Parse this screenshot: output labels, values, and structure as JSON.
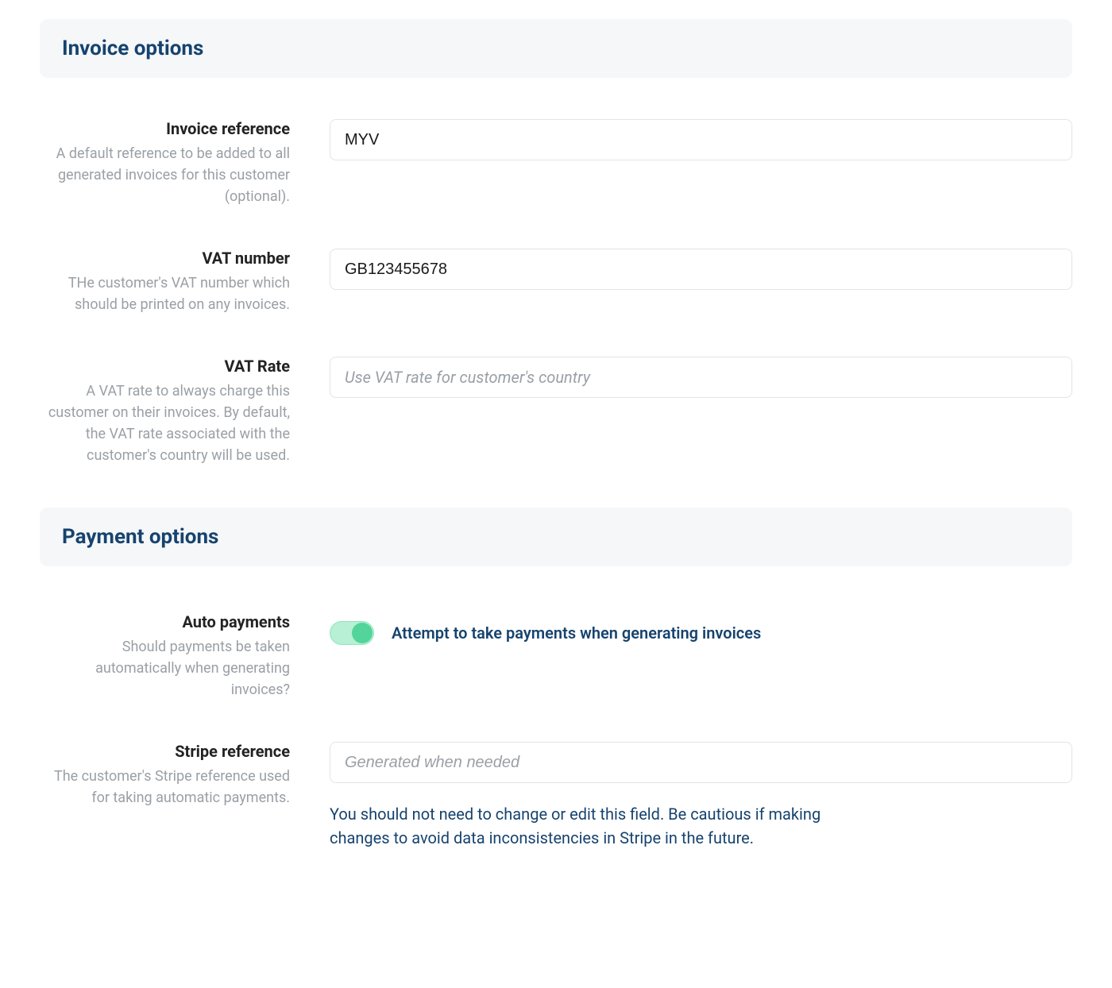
{
  "invoice_options": {
    "header": "Invoice options",
    "invoice_reference": {
      "label": "Invoice reference",
      "hint": "A default reference to be added to all generated invoices for this customer (optional).",
      "value": "MYV"
    },
    "vat_number": {
      "label": "VAT number",
      "hint": "THe customer's VAT number which should be printed on any invoices.",
      "value": "GB123455678"
    },
    "vat_rate": {
      "label": "VAT Rate",
      "hint": "A VAT rate to always charge this customer on their invoices. By default, the VAT rate associated with the customer's country will be used.",
      "placeholder": "Use VAT rate for customer's country",
      "value": ""
    }
  },
  "payment_options": {
    "header": "Payment options",
    "auto_payments": {
      "label": "Auto payments",
      "hint": "Should payments be taken automatically when generating invoices?",
      "toggle_label": "Attempt to take payments when generating invoices",
      "on": true
    },
    "stripe_reference": {
      "label": "Stripe reference",
      "hint": "The customer's Stripe reference used for taking automatic payments.",
      "placeholder": "Generated when needed",
      "value": "",
      "note": "You should not need to change or edit this field. Be cautious if making changes to avoid data inconsistencies in Stripe in the future."
    }
  }
}
